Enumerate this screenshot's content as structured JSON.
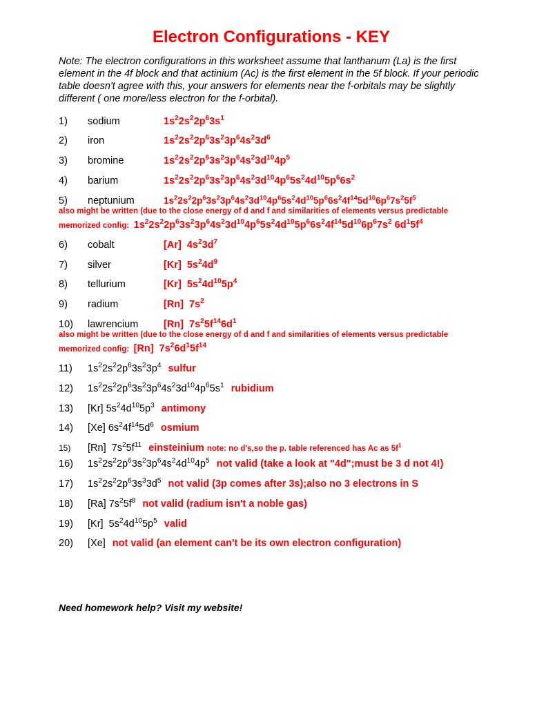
{
  "title": "Electron Configurations - KEY",
  "note": "Note:  The electron configurations in this worksheet assume that lanthanum (La) is the first element in the 4f block and that actinium (Ac) is the first element in the 5f block.  If your periodic table doesn't agree with this, your answers for elements near the f-orbitals may be slightly different ( one more/less electron for the  f-orbital).",
  "q1n": "1)",
  "q1l": "sodium",
  "q2n": "2)",
  "q2l": "iron",
  "q3n": "3)",
  "q3l": "bromine",
  "q4n": "4)",
  "q4l": "barium",
  "q5n": "5)",
  "q5l": "neptunium",
  "q5note": "also might be written (due to the close energy of d and f and similarities of elements versus predictable",
  "q5memo": "memorized config:",
  "q6n": "6)",
  "q6l": "cobalt",
  "q7n": "7)",
  "q7l": "silver",
  "q8n": "8)",
  "q8l": "tellurium",
  "q9n": "9)",
  "q9l": "radium",
  "q10n": "10)",
  "q10l": "lawrencium",
  "q10note": "also might be written (due to the close energy of d and f and similarities of elements versus predictable",
  "q10memo": "memorized config:",
  "q11n": "11)",
  "q11a": "sulfur",
  "q12n": "12)",
  "q12a": "rubidium",
  "q13n": "13)",
  "q13a": "antimony",
  "q14n": "14)",
  "q14a": "osmium",
  "q15n": "15)",
  "q15a": "einsteinium",
  "q15note": "note: no d's,so the p. table referenced has Ac  as 5f",
  "q16n": "16)",
  "q16a": "not valid",
  "q16note": "(take a look at \"4d\";must be 3 d not 4!)",
  "q17n": "17)",
  "q17a": "not valid (3p comes after 3s);",
  "q17b": " also no 3 electrons in S",
  "q18n": "18)",
  "q18a": "not valid (radium isn't a noble gas)",
  "q19n": "19)",
  "q19a": "valid",
  "q20n": "20)",
  "q20cfg": "[Xe]",
  "q20a": "not valid (an element can't be its own electron configuration)",
  "footer": "Need homework help?  Visit my website!"
}
